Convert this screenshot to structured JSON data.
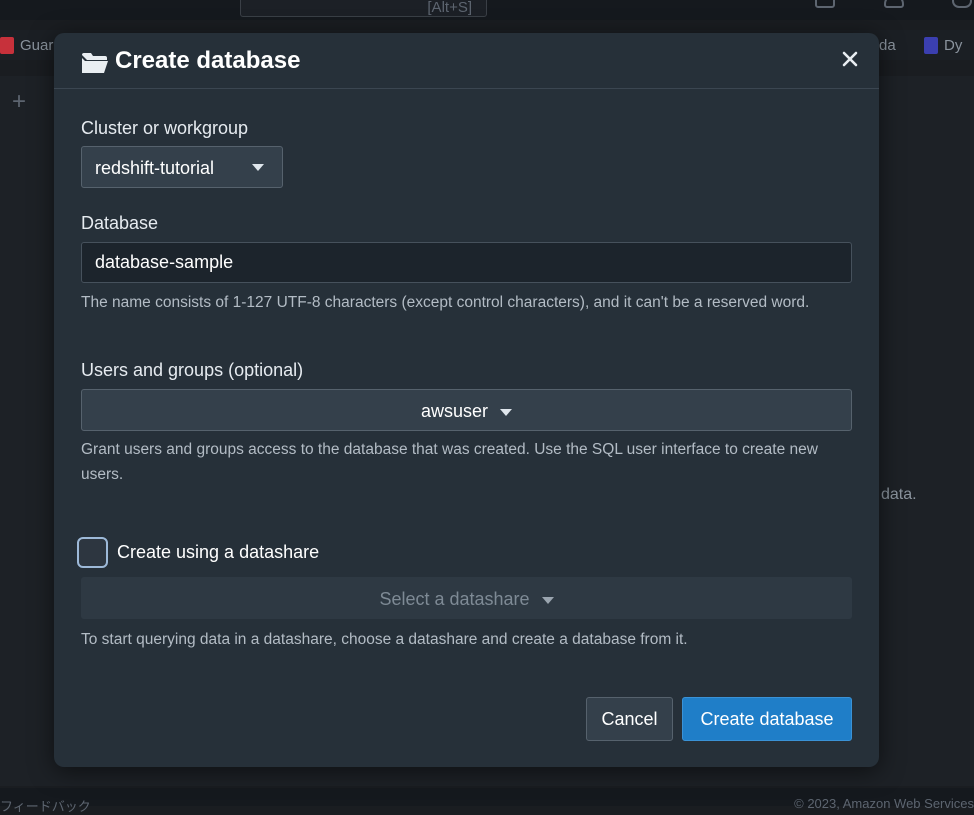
{
  "background": {
    "search_hint": "[Alt+S]",
    "favorites": [
      "Guard",
      "da",
      "Dy"
    ],
    "body_text": "data.",
    "footer_left": "フィードバック",
    "footer_right": "© 2023, Amazon Web Services"
  },
  "modal": {
    "title": "Create database",
    "cluster": {
      "label": "Cluster or workgroup",
      "value": "redshift-tutorial"
    },
    "database": {
      "label": "Database",
      "value": "database-sample",
      "hint": "The name consists of 1-127 UTF-8 characters (except control characters), and it can't be a reserved word."
    },
    "users": {
      "label": "Users and groups (optional)",
      "value": "awsuser",
      "hint": "Grant users and groups access to the database that was created. Use the SQL user interface to create new users."
    },
    "datashare": {
      "checkbox_label": "Create using a datashare",
      "checked": false,
      "placeholder": "Select a datashare",
      "hint": "To start querying data in a datashare, choose a datashare and create a database from it."
    },
    "buttons": {
      "cancel": "Cancel",
      "create": "Create database"
    }
  },
  "colors": {
    "modal_bg": "#263039",
    "primary": "#1f7ec8",
    "checkbox_border": "#9db9d8"
  },
  "icons": [
    "folder-open-icon",
    "close-icon",
    "chevron-down-icon",
    "plus-icon"
  ]
}
